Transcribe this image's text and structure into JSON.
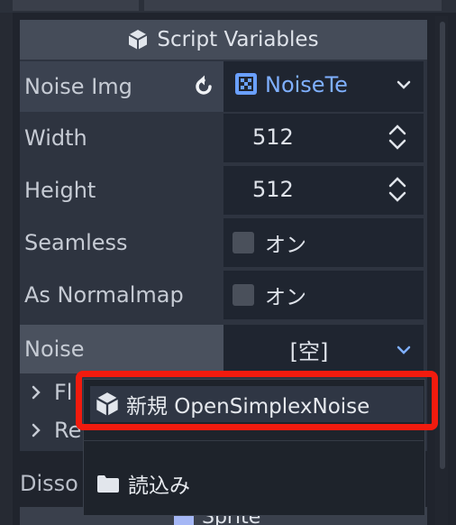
{
  "section": {
    "title": "Script Variables",
    "icon": "cube-icon"
  },
  "properties": [
    {
      "label": "Noise Img",
      "value": "NoiseTe",
      "revert_icon": "revert-icon",
      "resource_icon": "noise-texture-icon",
      "dropdown_icon": "chevron-down-icon"
    },
    {
      "label": "Width",
      "value": "512",
      "spin_icon": "spinner-arrows-icon"
    },
    {
      "label": "Height",
      "value": "512",
      "spin_icon": "spinner-arrows-icon"
    },
    {
      "label": "Seamless",
      "value": "オン",
      "checked": false
    },
    {
      "label": "As Normalmap",
      "value": "オン",
      "checked": false
    },
    {
      "label": "Noise",
      "value": "[空]",
      "dropdown_icon": "chevron-down-icon"
    }
  ],
  "subsections": [
    {
      "label": "Fl",
      "arrow": "chevron-right-icon"
    },
    {
      "label": "Re",
      "arrow": "chevron-right-icon"
    }
  ],
  "next_section_label": "Disso",
  "popup_menu": {
    "items": [
      {
        "label": "新規 OpenSimplexNoise",
        "icon": "cube-icon",
        "highlighted": true
      },
      {
        "label": "読込み",
        "icon": "folder-icon",
        "highlighted": false
      }
    ]
  },
  "bottom_node_label": "Sprite",
  "colors": {
    "highlight_box": "#f21b0e",
    "accent": "#6aa0ff"
  }
}
